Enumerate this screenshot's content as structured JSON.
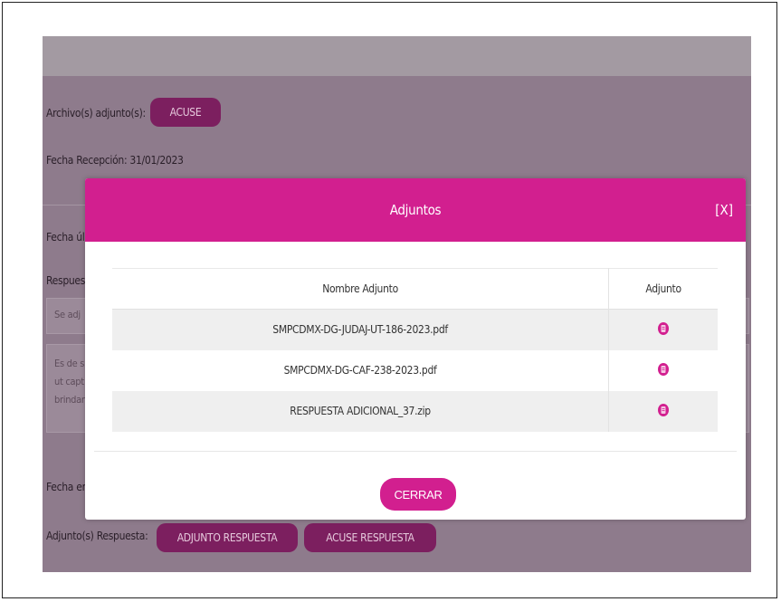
{
  "background": {
    "attachments_label": "Archivo(s) adjunto(s):",
    "acuse_button": "ACUSE",
    "fecha_recepcion": "Fecha Recepción: 31/01/2023",
    "fecha_ultima_partial": "Fecha úl",
    "respuesta_partial": "Respues",
    "box1_text": "Se adj",
    "box2_line1": "Es de s",
    "box2_line2": "ut capt",
    "box2_line3": "brindar",
    "fecha_envio_partial": "Fecha en",
    "adjuntos_respuesta_label": "Adjunto(s) Respuesta:",
    "adjunto_respuesta_button": "ADJUNTO RESPUESTA",
    "acuse_respuesta_button": "ACUSE RESPUESTA"
  },
  "modal": {
    "title": "Adjuntos",
    "close": "[X]",
    "table": {
      "headers": [
        "Nombre Adjunto",
        "Adjunto"
      ],
      "rows": [
        {
          "name": "SMPCDMX-DG-JUDAJ-UT-186-2023.pdf",
          "icon": "file-icon"
        },
        {
          "name": "SMPCDMX-DG-CAF-238-2023.pdf",
          "icon": "file-icon"
        },
        {
          "name": "RESPUESTA ADICIONAL_37.zip",
          "icon": "file-icon"
        }
      ]
    },
    "cerrar_button": "CERRAR"
  },
  "colors": {
    "accent": "#d21f8f",
    "overlay_bg": "#8e7b8c",
    "dark_button": "#7c1f5f"
  }
}
